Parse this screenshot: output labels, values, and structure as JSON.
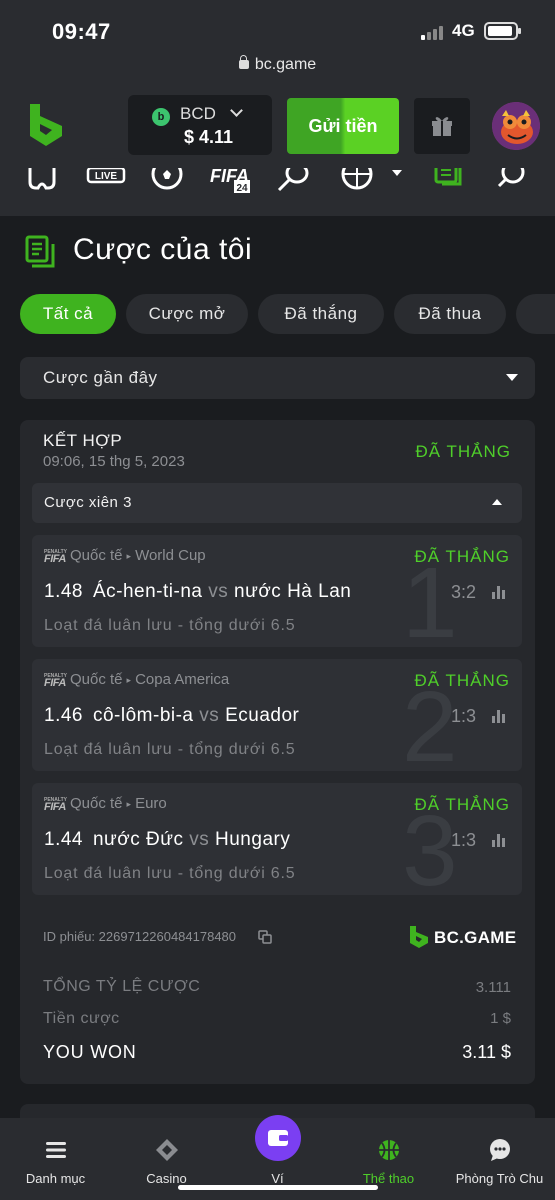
{
  "status": {
    "time": "09:47",
    "network": "4G",
    "url": "bc.game"
  },
  "header": {
    "currency": "BCD",
    "currency_icon": "bcd-coin-icon",
    "balance": "$ 4.11",
    "deposit_label": "Gửi tiền",
    "brand_color": "#3fb31f"
  },
  "sports_nav": [
    "home-icon",
    "live-icon",
    "soccer-icon",
    "fifa-icon",
    "tennis-icon",
    "basketball-icon",
    "my-bets-icon",
    "search-icon"
  ],
  "page": {
    "title": "Cược của tôi"
  },
  "filters": [
    {
      "label": "Tất cả",
      "active": true
    },
    {
      "label": "Cược mở",
      "active": false
    },
    {
      "label": "Đã thắng",
      "active": false
    },
    {
      "label": "Đã thua",
      "active": false
    }
  ],
  "select": {
    "value": "Cược gần đây"
  },
  "bet": {
    "type": "KẾT HỢP",
    "time": "09:06, 15 thg 5, 2023",
    "status": "ĐÃ THẮNG",
    "parlay_label": "Cược xiên 3",
    "legs": [
      {
        "num": "1",
        "badge_top": "PENALTY",
        "badge_main": "FIFA",
        "region": "Quốc tế",
        "league": "World Cup",
        "status": "ĐÃ THẮNG",
        "odds": "1.48",
        "home": "Ác-hen-ti-na",
        "vs": "vs",
        "away": "nước Hà Lan",
        "score": "3:2",
        "market": "Loạt đá luân lưu - tổng dưới 6.5"
      },
      {
        "num": "2",
        "badge_top": "PENALTY",
        "badge_main": "FIFA",
        "region": "Quốc tế",
        "league": "Copa America",
        "status": "ĐÃ THẮNG",
        "odds": "1.46",
        "home": "cô-lôm-bi-a",
        "vs": "vs",
        "away": "Ecuador",
        "score": "1:3",
        "market": "Loạt đá luân lưu - tổng dưới 6.5"
      },
      {
        "num": "3",
        "badge_top": "PENALTY",
        "badge_main": "FIFA",
        "region": "Quốc tế",
        "league": "Euro",
        "status": "ĐÃ THẮNG",
        "odds": "1.44",
        "home": "nước Đức",
        "vs": "vs",
        "away": "Hungary",
        "score": "1:3",
        "market": "Loạt đá luân lưu - tổng dưới 6.5"
      }
    ],
    "ticket": "ID phiếu: 2269712260484178480",
    "brand": "BC.GAME",
    "total_odds_label": "TỔNG TỶ LỆ CƯỢC",
    "total_odds": "3.111",
    "stake_label": "Tiền cược",
    "stake": "1 $",
    "won_label": "YOU WON",
    "won_amount": "3.11 $"
  },
  "bottom_nav": [
    {
      "label": "Danh mục",
      "icon": "menu-icon"
    },
    {
      "label": "Casino",
      "icon": "casino-icon"
    },
    {
      "label": "Ví",
      "icon": "wallet-icon"
    },
    {
      "label": "Thể thao",
      "icon": "basketball-icon",
      "active": true
    },
    {
      "label": "Phòng Trò Chu",
      "icon": "chat-icon"
    }
  ]
}
